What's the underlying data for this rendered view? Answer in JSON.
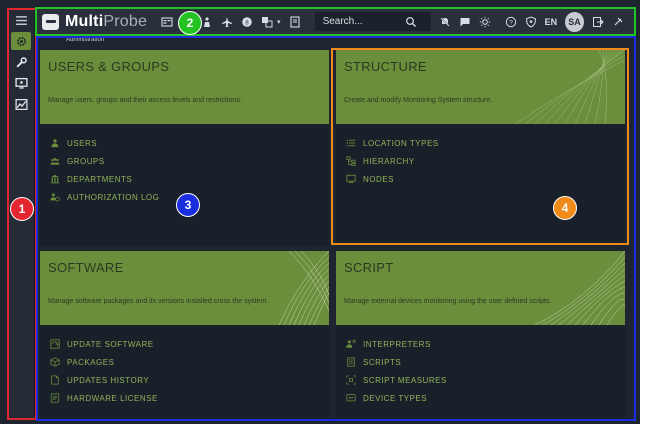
{
  "header": {
    "brand_part1": "Multi",
    "brand_part2": "Probe",
    "search_placeholder": "Search...",
    "lang": "EN",
    "avatar_initials": "SA"
  },
  "breadcrumb": "Administration",
  "cards": [
    {
      "title": "USERS & GROUPS",
      "description": "Manage users, groups and their access levels and restrictions.",
      "items": [
        {
          "label": "USERS",
          "icon": "user-icon"
        },
        {
          "label": "GROUPS",
          "icon": "group-icon"
        },
        {
          "label": "DEPARTMENTS",
          "icon": "building-icon"
        },
        {
          "label": "AUTHORIZATION LOG",
          "icon": "user-clock-icon"
        }
      ]
    },
    {
      "title": "STRUCTURE",
      "description": "Create and modify Monitoring System structure.",
      "items": [
        {
          "label": "LOCATION TYPES",
          "icon": "list-icon"
        },
        {
          "label": "HIERARCHY",
          "icon": "hierarchy-icon"
        },
        {
          "label": "NODES",
          "icon": "monitor-icon"
        }
      ]
    },
    {
      "title": "SOFTWARE",
      "description": "Manage software packages and its versions installed cross the system.",
      "items": [
        {
          "label": "UPDATE SOFTWARE",
          "icon": "update-icon"
        },
        {
          "label": "PACKAGES",
          "icon": "package-icon"
        },
        {
          "label": "UPDATES HISTORY",
          "icon": "file-icon"
        },
        {
          "label": "HARDWARE LICENSE",
          "icon": "license-icon"
        }
      ]
    },
    {
      "title": "SCRIPT",
      "description": "Manage external devices monitoring using the user defined scripts.",
      "items": [
        {
          "label": "INTERPRETERS",
          "icon": "interpreter-icon"
        },
        {
          "label": "SCRIPTS",
          "icon": "script-icon"
        },
        {
          "label": "SCRIPT MEASURES",
          "icon": "measure-icon"
        },
        {
          "label": "DEVICE TYPES",
          "icon": "device-icon"
        }
      ]
    }
  ],
  "annotations": [
    {
      "number": "1",
      "color": "#e3262f"
    },
    {
      "number": "2",
      "color": "#22c322"
    },
    {
      "number": "3",
      "color": "#1a2ee0"
    },
    {
      "number": "4",
      "color": "#f08a18"
    }
  ],
  "colors": {
    "accent_green": "#6b8e3d",
    "item_text": "#8fb35a",
    "background": "#1f2530"
  }
}
